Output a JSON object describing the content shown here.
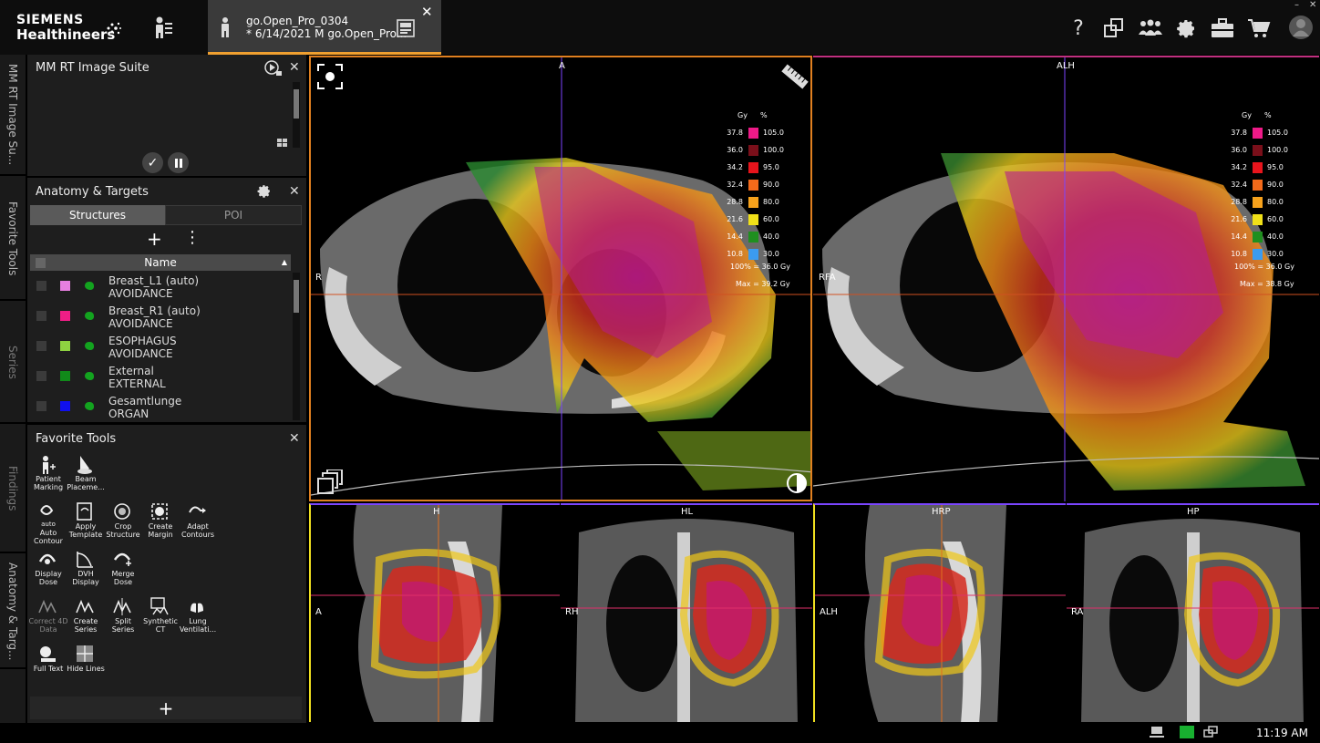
{
  "brand": {
    "line1": "SIEMENS",
    "line2": "Healthineers"
  },
  "patient_tab": {
    "line1": "go.Open_Pro_0304",
    "line2": "* 6/14/2021 M go.Open_Pro..."
  },
  "header_icons": [
    "help-icon",
    "layout-icon",
    "users-icon",
    "gear-icon",
    "briefcase-icon",
    "cart-icon",
    "avatar-icon"
  ],
  "left_rail": [
    {
      "label": "MM RT Image Su..."
    },
    {
      "label": "Favorite Tools"
    },
    {
      "label": "Series"
    },
    {
      "label": "Findings"
    },
    {
      "label": "Anatomy & Targ..."
    }
  ],
  "panels": {
    "image_suite": {
      "title": "MM RT Image Suite"
    },
    "anatomy": {
      "title": "Anatomy & Targets",
      "tabs": [
        {
          "label": "Structures",
          "active": true
        },
        {
          "label": "POI",
          "active": false
        }
      ],
      "column": "Name",
      "structures": [
        {
          "name": "Breast_L1 (auto)",
          "type": "AVOIDANCE",
          "color": "#e77fe0"
        },
        {
          "name": "Breast_R1 (auto)",
          "type": "AVOIDANCE",
          "color": "#ef1e86"
        },
        {
          "name": "ESOPHAGUS",
          "type": "AVOIDANCE",
          "color": "#8ed241"
        },
        {
          "name": "External",
          "type": "EXTERNAL",
          "color": "#118a1a"
        },
        {
          "name": "Gesamtlunge",
          "type": "ORGAN",
          "color": "#1010ee"
        }
      ]
    },
    "favorite_tools": {
      "title": "Favorite Tools",
      "tools": [
        {
          "label": "Patient Marking",
          "icon": "patient-marking-icon"
        },
        {
          "label": "Beam Placeme...",
          "icon": "beam-placement-icon"
        },
        {
          "label": "Auto Contour",
          "icon": "auto-contour-icon",
          "badge": "auto"
        },
        {
          "label": "Apply Template",
          "icon": "apply-template-icon"
        },
        {
          "label": "Crop Structure",
          "icon": "crop-structure-icon"
        },
        {
          "label": "Create Margin",
          "icon": "create-margin-icon"
        },
        {
          "label": "Adapt Contours",
          "icon": "adapt-contours-icon"
        },
        {
          "label": "Display Dose",
          "icon": "display-dose-icon"
        },
        {
          "label": "DVH Display",
          "icon": "dvh-display-icon"
        },
        {
          "label": "Merge Dose",
          "icon": "merge-dose-icon"
        },
        {
          "label": "Correct 4D Data",
          "icon": "correct-4d-icon",
          "disabled": true
        },
        {
          "label": "Create Series",
          "icon": "create-series-icon"
        },
        {
          "label": "Split Series",
          "icon": "split-series-icon"
        },
        {
          "label": "Synthetic CT",
          "icon": "synthetic-ct-icon"
        },
        {
          "label": "Lung Ventilati...",
          "icon": "lung-ventilation-icon"
        },
        {
          "label": "Full Text",
          "icon": "full-text-icon"
        },
        {
          "label": "Hide Lines",
          "icon": "hide-lines-icon"
        }
      ]
    }
  },
  "dose_legend": {
    "units": {
      "gy": "Gy",
      "pct": "%"
    },
    "rows": [
      {
        "gy": "37.8",
        "pct": "105.0",
        "color": "#ee1a88"
      },
      {
        "gy": "36.0",
        "pct": "100.0",
        "color": "#7a0f1a"
      },
      {
        "gy": "34.2",
        "pct": "95.0",
        "color": "#e8141c"
      },
      {
        "gy": "32.4",
        "pct": "90.0",
        "color": "#f46a1a"
      },
      {
        "gy": "28.8",
        "pct": "80.0",
        "color": "#f7a21c"
      },
      {
        "gy": "21.6",
        "pct": "60.0",
        "color": "#f0e018"
      },
      {
        "gy": "14.4",
        "pct": "40.0",
        "color": "#1f8f1f"
      },
      {
        "gy": "10.8",
        "pct": "30.0",
        "color": "#3b9bf0"
      }
    ],
    "ref_left": "100% = 36.0 Gy",
    "max_left": "Max = 39.2 Gy",
    "ref_right": "100% = 36.0 Gy",
    "max_right": "Max = 38.8 Gy"
  },
  "viewers": {
    "axial_left": {
      "top": "A",
      "left": "R"
    },
    "axial_right": {
      "top": "ALH",
      "left": "RFA"
    },
    "sag1": {
      "top": "H",
      "left": "A"
    },
    "cor1": {
      "top": "HL",
      "left": "RH"
    },
    "sag2": {
      "top": "HRP",
      "left": "ALH"
    },
    "cor2": {
      "top": "HP",
      "left": "RA"
    }
  },
  "status": {
    "time": "11:19 AM"
  }
}
